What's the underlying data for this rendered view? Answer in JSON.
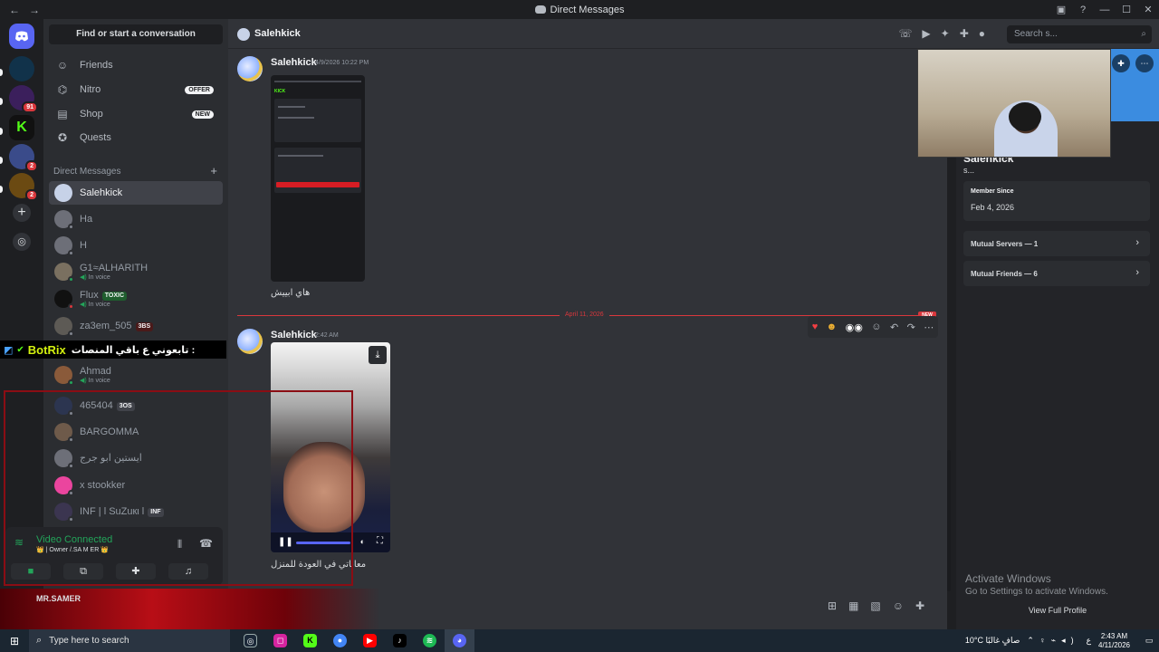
{
  "window": {
    "title": "Direct Messages"
  },
  "sidebar": {
    "find_placeholder": "Find or start a conversation",
    "nav": [
      {
        "label": "Friends"
      },
      {
        "label": "Nitro",
        "tag": "OFFER"
      },
      {
        "label": "Shop",
        "tag": "NEW"
      },
      {
        "label": "Quests"
      }
    ],
    "dm_header": "Direct Messages",
    "dms": [
      {
        "name": "Salehkick"
      },
      {
        "name": "Ha"
      },
      {
        "name": "H"
      },
      {
        "name": "G1≈ALHARITH",
        "sub": "In voice"
      },
      {
        "name": "Flux",
        "tag": "TOXIC",
        "sub": "In voice"
      },
      {
        "name": "za3em_505",
        "tag": "3BS"
      },
      {
        "name": "Ahmad",
        "sub": "In voice"
      },
      {
        "name": "465404",
        "tag": "3OS"
      },
      {
        "name": "BARGOMMA"
      },
      {
        "name": "ايستين ابو جرج"
      },
      {
        "name": "x stookker"
      },
      {
        "name": "INF | l SuZuкι l",
        "tag": "INF"
      }
    ],
    "voice": {
      "status": "Video Connected",
      "channel": "👑 | Owner /.SA M ER 👑"
    }
  },
  "overlay": {
    "bot_name": "BotRix",
    "bot_text": "تابعوني ع باقي المنصات :",
    "user_name": "MR.SAMER"
  },
  "chat": {
    "header_name": "Salehkick",
    "search_placeholder": "Search s...",
    "messages": [
      {
        "author": "Salehkick",
        "time": "4/9/2026 10:22 PM",
        "caption": "هاي ابييش"
      },
      {
        "author": "Salehkick",
        "time": "2:42 AM",
        "caption": "معاناتي في العودة للمنزل"
      }
    ],
    "date_divider": "April 11, 2026",
    "new_label": "NEW"
  },
  "profile": {
    "name": "Salehkick",
    "username": "s...",
    "member_since_label": "Member Since",
    "member_since": "Feb 4, 2026",
    "mutual_servers": "Mutual Servers — 1",
    "mutual_friends": "Mutual Friends — 6",
    "view_full": "View Full Profile"
  },
  "watermark": {
    "line1": "Activate Windows",
    "line2": "Go to Settings to activate Windows."
  },
  "taskbar": {
    "search_placeholder": "Type here to search",
    "weather": "10°C  صافٍ غالبًا",
    "lang": "ع",
    "time": "2:43 AM",
    "date": "4/11/2026"
  },
  "colors": {
    "brand": "#5865f2",
    "online": "#23a55a",
    "alert": "#da373c"
  }
}
